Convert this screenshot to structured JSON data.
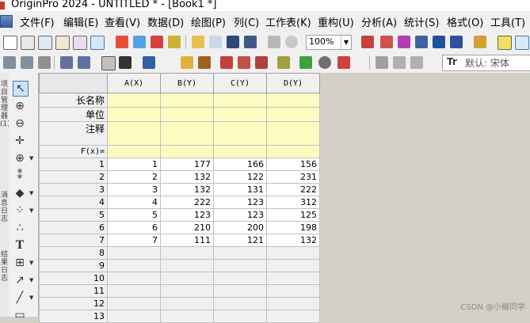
{
  "window": {
    "title": "OriginPro 2024 - UNTITLED * - [Book1 *]"
  },
  "menu": [
    {
      "label": "文件(F)"
    },
    {
      "label": "编辑(E)"
    },
    {
      "label": "查看(V)"
    },
    {
      "label": "数据(D)"
    },
    {
      "label": "绘图(P)"
    },
    {
      "label": "列(C)"
    },
    {
      "label": "工作表(K)"
    },
    {
      "label": "重构(U)"
    },
    {
      "label": "分析(A)"
    },
    {
      "label": "统计(S)"
    },
    {
      "label": "格式(O)"
    },
    {
      "label": "工具(T)"
    }
  ],
  "toolbar": {
    "zoom": "100%",
    "font_name": "默认: 宋体",
    "font_icon": "Tr"
  },
  "side_labels": {
    "upper": "项目管理器(1)",
    "lower": "消息日志",
    "bottom": "结果日志"
  },
  "worksheet": {
    "columns": [
      "A(X)",
      "B(Y)",
      "C(Y)",
      "D(Y)"
    ],
    "label_rows": [
      "长名称",
      "单位",
      "注释",
      "F(x)="
    ],
    "rows": [
      {
        "n": "1",
        "a": "1",
        "b": "177",
        "c": "166",
        "d": "156"
      },
      {
        "n": "2",
        "a": "2",
        "b": "132",
        "c": "122",
        "d": "231"
      },
      {
        "n": "3",
        "a": "3",
        "b": "132",
        "c": "131",
        "d": "222"
      },
      {
        "n": "4",
        "a": "4",
        "b": "222",
        "c": "123",
        "d": "312"
      },
      {
        "n": "5",
        "a": "5",
        "b": "123",
        "c": "123",
        "d": "125"
      },
      {
        "n": "6",
        "a": "6",
        "b": "210",
        "c": "200",
        "d": "198"
      },
      {
        "n": "7",
        "a": "7",
        "b": "111",
        "c": "121",
        "d": "132"
      }
    ],
    "empty_rows": [
      "8",
      "9",
      "10",
      "11",
      "12",
      "13"
    ]
  },
  "watermark": "CSDN @小耀同学"
}
